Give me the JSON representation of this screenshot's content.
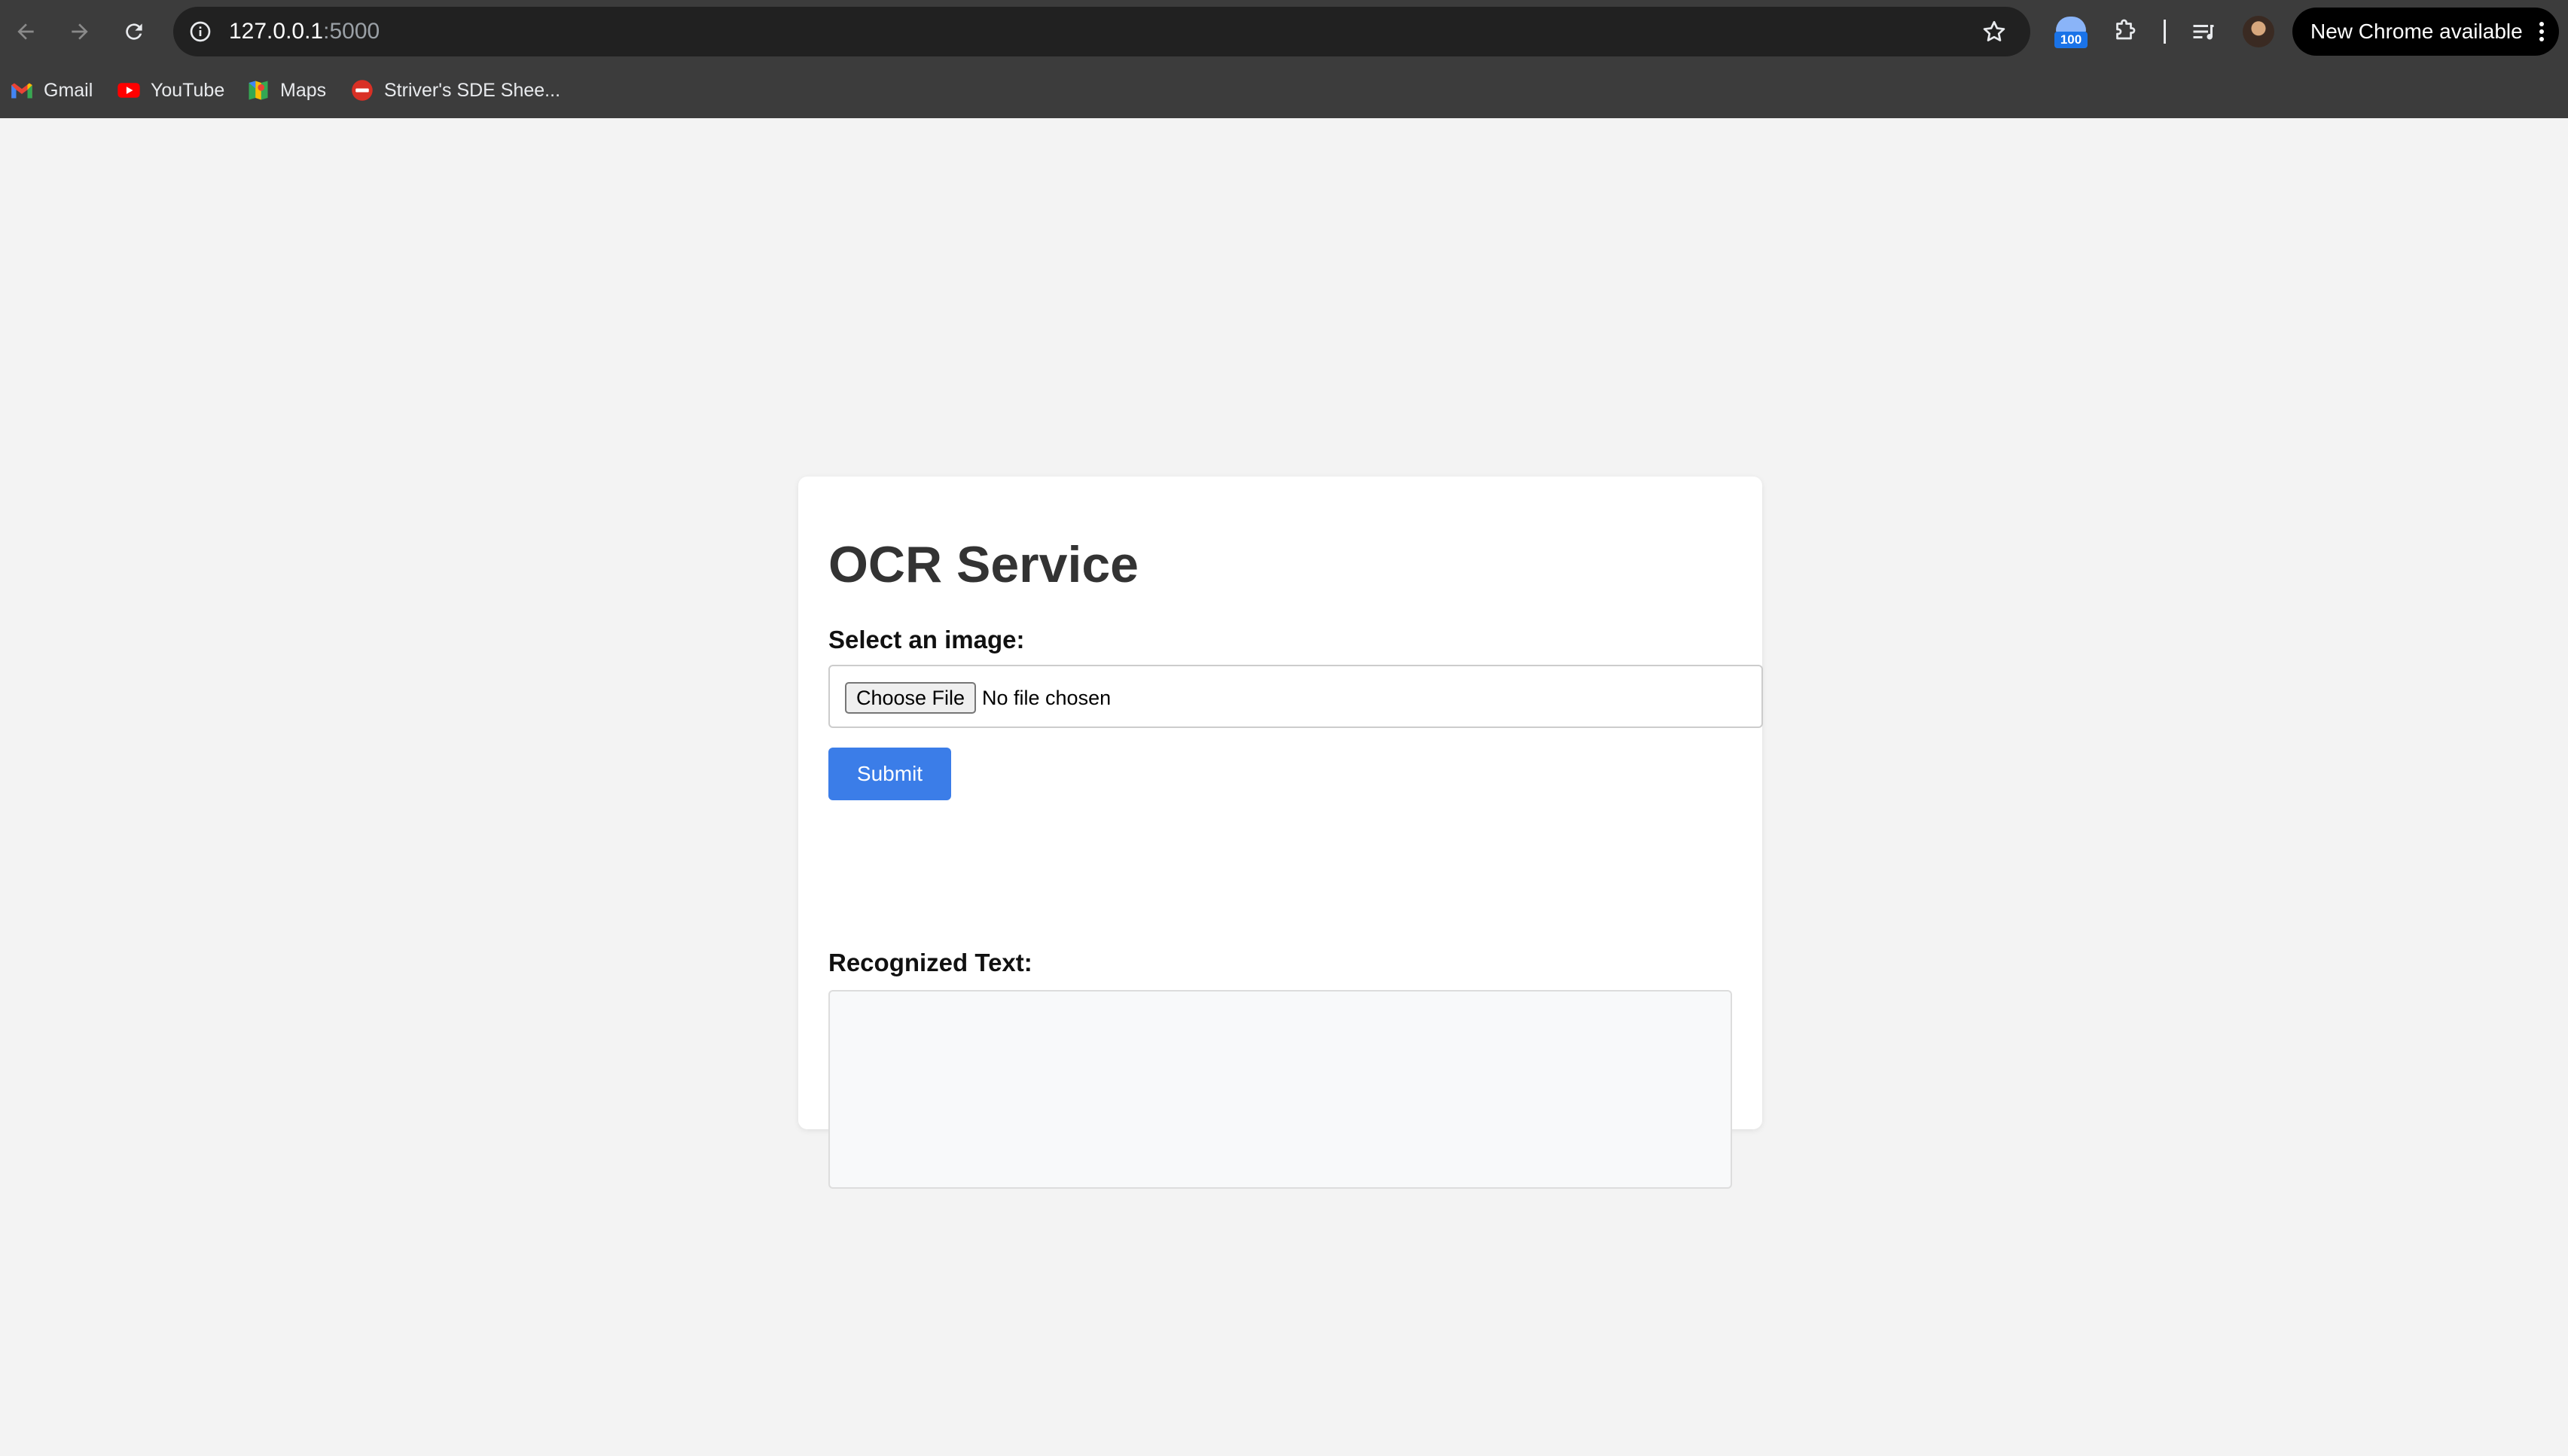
{
  "browser": {
    "url_host": "127.0.0.1",
    "url_port": ":5000",
    "extension_badge": "100",
    "update_label": "New Chrome available"
  },
  "bookmarks": [
    {
      "label": "Gmail",
      "icon": "gmail-icon"
    },
    {
      "label": "YouTube",
      "icon": "youtube-icon"
    },
    {
      "label": "Maps",
      "icon": "maps-icon"
    },
    {
      "label": "Striver's SDE Shee...",
      "icon": "tuf-icon"
    }
  ],
  "page": {
    "title": "OCR Service",
    "file_label": "Select an image:",
    "choose_file_label": "Choose File",
    "no_file_text": "No file chosen",
    "submit_label": "Submit",
    "result_label": "Recognized Text:",
    "result_text": ""
  },
  "colors": {
    "accent": "#3b7de8",
    "page_bg": "#f3f3f3",
    "chrome_bg": "#3c3c3c"
  }
}
